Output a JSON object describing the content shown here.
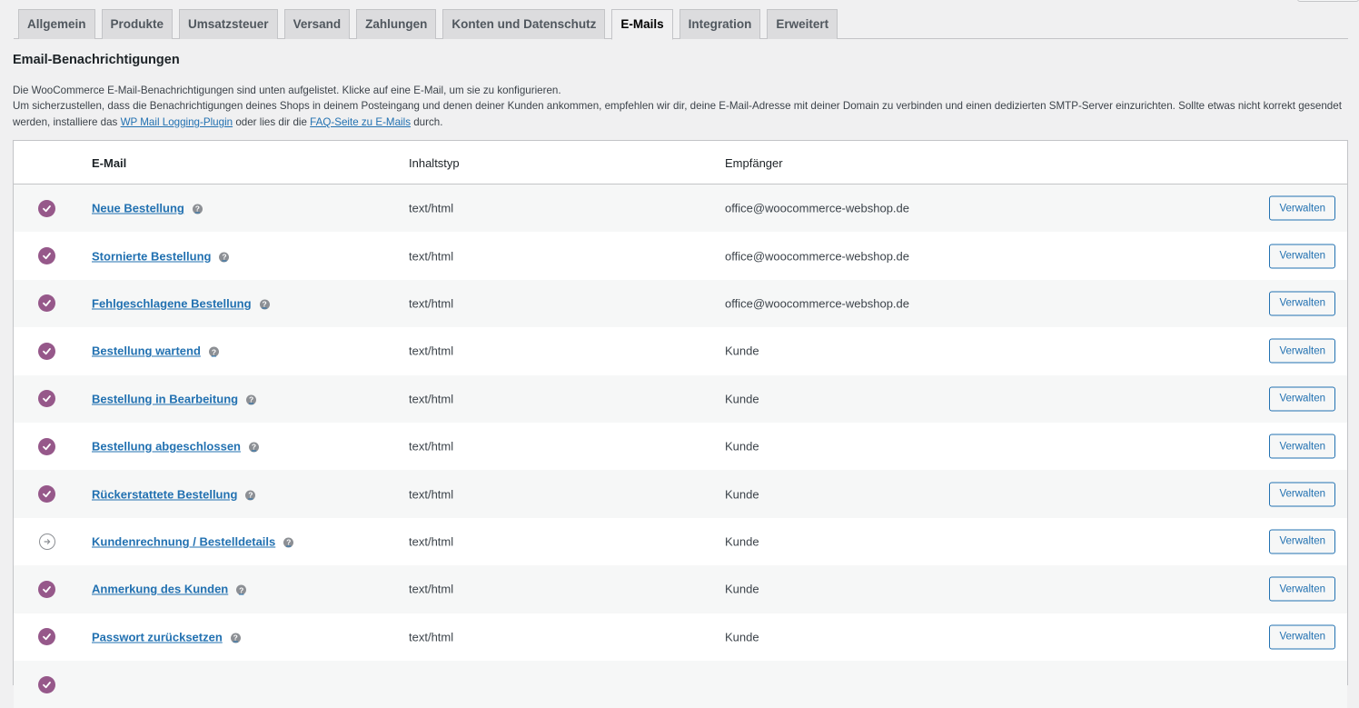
{
  "tabs": [
    {
      "label": "Allgemein",
      "active": false
    },
    {
      "label": "Produkte",
      "active": false
    },
    {
      "label": "Umsatzsteuer",
      "active": false
    },
    {
      "label": "Versand",
      "active": false
    },
    {
      "label": "Zahlungen",
      "active": false
    },
    {
      "label": "Konten und Datenschutz",
      "active": false
    },
    {
      "label": "E-Mails",
      "active": true
    },
    {
      "label": "Integration",
      "active": false
    },
    {
      "label": "Erweitert",
      "active": false
    }
  ],
  "section": {
    "title": "Email-Benachrichtigungen",
    "desc_line1": "Die WooCommerce E-Mail-Benachrichtigungen sind unten aufgelistet. Klicke auf eine E-Mail, um sie zu konfigurieren.",
    "desc_line2_start": "Um sicherzustellen, dass die Benachrichtigungen deines Shops in deinem Posteingang und denen deiner Kunden ankommen, empfehlen wir dir, deine E-Mail-Adresse mit deiner Domain zu verbinden und einen dedizierten SMTP-Server einzurichten. Sollte etwas nicht korrekt gesendet werden, installiere das ",
    "link1": "WP Mail Logging-Plugin",
    "desc_mid": " oder lies dir die ",
    "link2": "FAQ-Seite zu E-Mails",
    "desc_end": " durch."
  },
  "table": {
    "headers": {
      "email": "E-Mail",
      "content_type": "Inhaltstyp",
      "recipient": "Empfänger"
    },
    "help_glyph": "?",
    "rows": [
      {
        "status": "enabled",
        "name": "Neue Bestellung",
        "content_type": "text/html",
        "recipient": "office@woocommerce-webshop.de",
        "action": "Verwalten"
      },
      {
        "status": "enabled",
        "name": "Stornierte Bestellung",
        "content_type": "text/html",
        "recipient": "office@woocommerce-webshop.de",
        "action": "Verwalten"
      },
      {
        "status": "enabled",
        "name": "Fehlgeschlagene Bestellung",
        "content_type": "text/html",
        "recipient": "office@woocommerce-webshop.de",
        "action": "Verwalten"
      },
      {
        "status": "enabled",
        "name": "Bestellung wartend",
        "content_type": "text/html",
        "recipient": "Kunde",
        "action": "Verwalten"
      },
      {
        "status": "enabled",
        "name": "Bestellung in Bearbeitung",
        "content_type": "text/html",
        "recipient": "Kunde",
        "action": "Verwalten"
      },
      {
        "status": "enabled",
        "name": "Bestellung abgeschlossen",
        "content_type": "text/html",
        "recipient": "Kunde",
        "action": "Verwalten"
      },
      {
        "status": "enabled",
        "name": "Rückerstattete Bestellung",
        "content_type": "text/html",
        "recipient": "Kunde",
        "action": "Verwalten"
      },
      {
        "status": "manual",
        "name": "Kundenrechnung / Bestelldetails",
        "content_type": "text/html",
        "recipient": "Kunde",
        "action": "Verwalten"
      },
      {
        "status": "enabled",
        "name": "Anmerkung des Kunden",
        "content_type": "text/html",
        "recipient": "Kunde",
        "action": "Verwalten"
      },
      {
        "status": "enabled",
        "name": "Passwort zurücksetzen",
        "content_type": "text/html",
        "recipient": "Kunde",
        "action": "Verwalten"
      },
      {
        "status": "enabled",
        "name": "",
        "content_type": "",
        "recipient": "",
        "action": ""
      }
    ]
  },
  "colors": {
    "accent": "#96588a",
    "link": "#2271b1"
  }
}
